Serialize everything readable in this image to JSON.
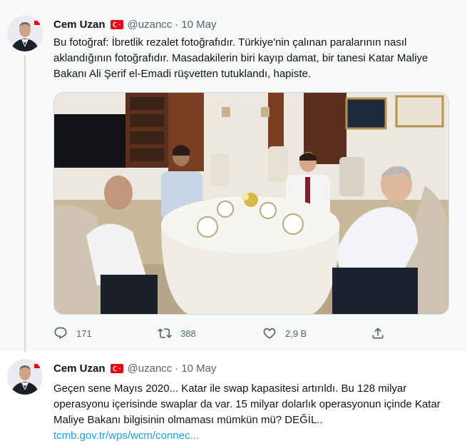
{
  "tweets": [
    {
      "author_name": "Cem Uzan",
      "author_handle": "@uzancc",
      "separator": "·",
      "date": "10 May",
      "text": "Bu fotoğraf: İbretlik rezalet fotoğrafıdır. Türkiye'nin çalınan paralarının nasıl aklandığının fotoğrafıdır. Masadakilerin biri kayıp damat, bir tanesi Katar Maliye Bakanı Ali Şerif el-Emadi rüşvetten tutuklandı, hapiste.",
      "replies": "171",
      "retweets": "388",
      "likes": "2,9 B",
      "icons": [
        "reply-icon",
        "retweet-icon",
        "like-icon",
        "share-icon"
      ]
    },
    {
      "author_name": "Cem Uzan",
      "author_handle": "@uzancc",
      "separator": "·",
      "date": "10 May",
      "text": "Geçen sene Mayıs 2020... Katar ile swap kapasitesi artırıldı. Bu 128 milyar operasyonu içerisinde swaplar da var. 15 milyar dolarlık operasyonun içinde Katar Maliye Bakanı bilgisinin olmaması mümkün mü?  DEĞİL..",
      "link": "tcmb.gov.tr/wps/wcm/connec..."
    }
  ],
  "colors": {
    "accent": "#1d9bf0",
    "secondary_text": "#536471",
    "flag_red": "#e30a17"
  }
}
